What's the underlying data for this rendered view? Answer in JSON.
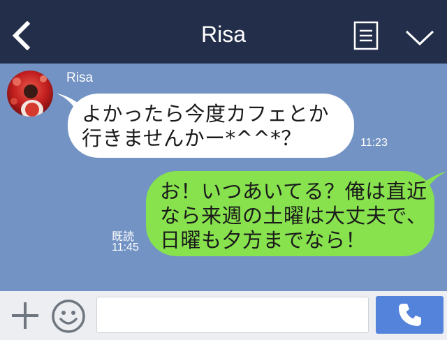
{
  "header": {
    "title": "Risa",
    "back_icon": "chevron-left-icon",
    "menu_icon": "note-icon",
    "expand_icon": "chevron-down-icon"
  },
  "messages": [
    {
      "direction": "incoming",
      "sender": "Risa",
      "text": "よかったら今度カフェとか行きませんかー*^^*？",
      "time": "11:23"
    },
    {
      "direction": "outgoing",
      "text": "お！いつあいてる？俺は直近なら来週の土曜は大丈夫で、日曜も夕方までなら！",
      "read_label": "既読",
      "time": "11:45"
    }
  ],
  "input_bar": {
    "plus_icon": "plus-icon",
    "emoji_icon": "smiley-icon",
    "placeholder": "",
    "call_icon": "phone-icon"
  },
  "colors": {
    "header_bg": "#232f4a",
    "chat_bg": "#7393c4",
    "incoming_bubble": "#ffffff",
    "outgoing_bubble": "#87e24e",
    "input_bar_bg": "#eceef1",
    "call_button": "#5483dc"
  }
}
